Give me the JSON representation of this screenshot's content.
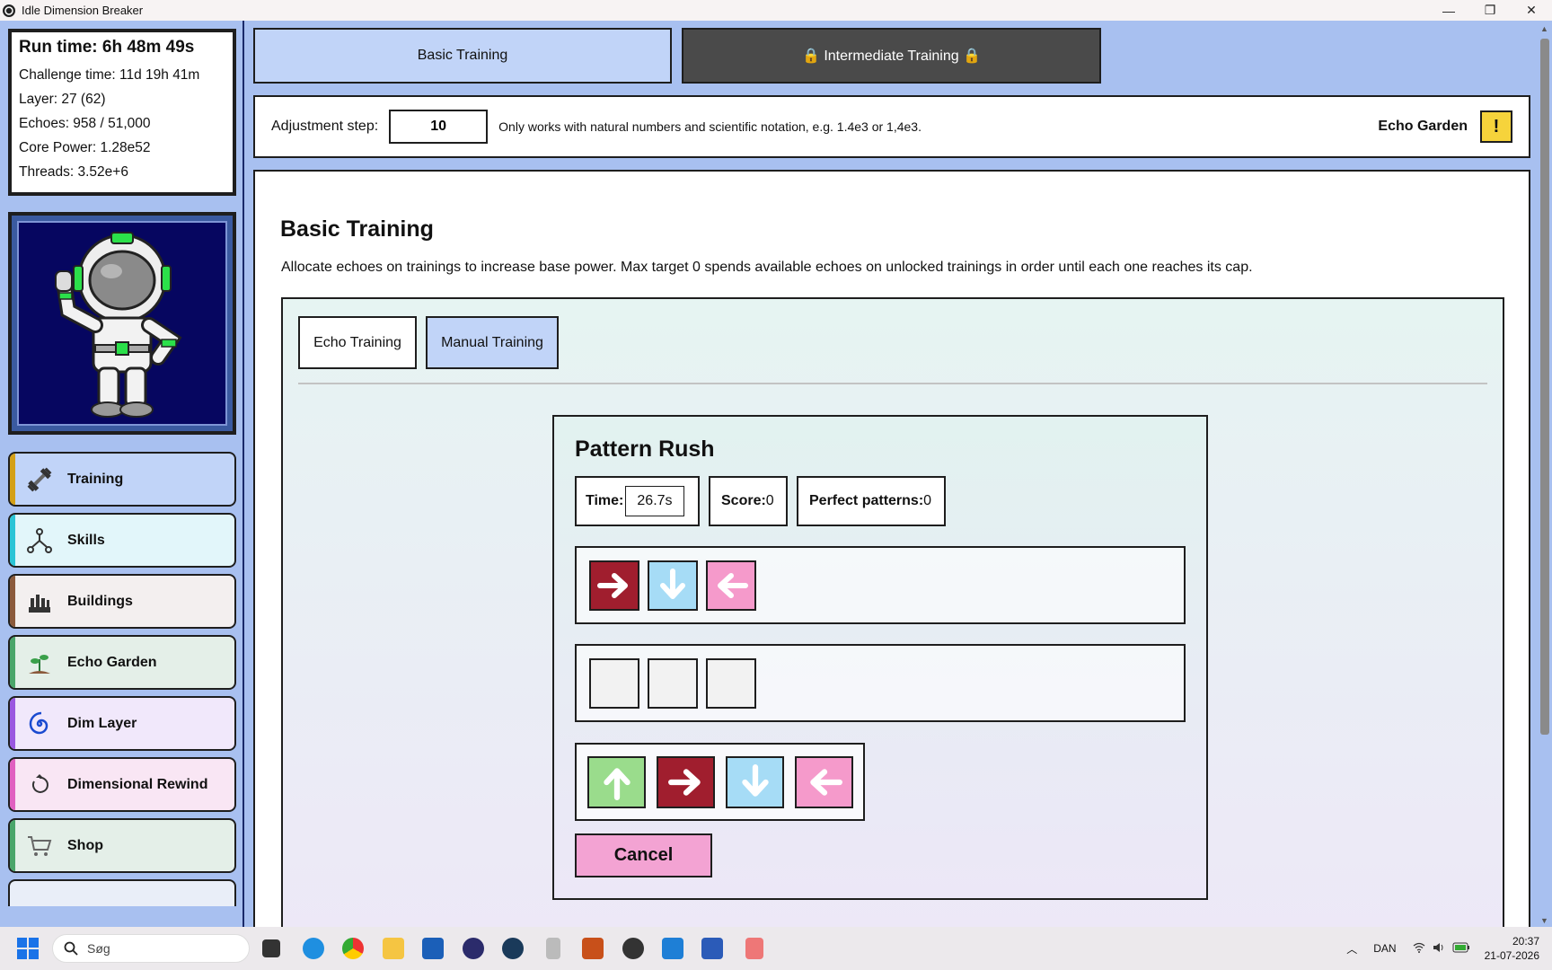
{
  "window": {
    "title": "Idle Dimension Breaker",
    "controls": [
      "—",
      "❐",
      "✕"
    ]
  },
  "stats": {
    "run_time": "Run time: 6h 48m 49s",
    "challenge_time": "Challenge time: 11d 19h 41m",
    "layer": "Layer: 27 (62)",
    "echoes": "Echoes: 958 / 51,000",
    "core_power": "Core Power: 1.28e52",
    "threads": "Threads: 3.52e+6"
  },
  "nav": [
    {
      "label": "Training",
      "bg": "#c1d4f8",
      "stripe": "#d4a017",
      "icon": "dumbbell-icon"
    },
    {
      "label": "Skills",
      "bg": "#e2f6fa",
      "stripe": "#2bc4d6",
      "icon": "skills-icon"
    },
    {
      "label": "Buildings",
      "bg": "#f3efef",
      "stripe": "#8b5a3c",
      "icon": "buildings-icon"
    },
    {
      "label": "Echo Garden",
      "bg": "#e4efe8",
      "stripe": "#4aa56a",
      "icon": "garden-icon"
    },
    {
      "label": "Dim Layer",
      "bg": "#f1e8fb",
      "stripe": "#9a58e0",
      "icon": "spiral-icon"
    },
    {
      "label": "Dimensional Rewind",
      "bg": "#f9e6f4",
      "stripe": "#e060c0",
      "icon": "rewind-icon"
    },
    {
      "label": "Shop",
      "bg": "#e4efe8",
      "stripe": "#4aa56a",
      "icon": "cart-icon"
    }
  ],
  "top_tabs": {
    "basic": "Basic Training",
    "intermediate": "🔒 Intermediate Training 🔒"
  },
  "adjust": {
    "label": "Adjustment step:",
    "value": "10",
    "hint": "Only works with natural numbers and scientific notation, e.g. 1.4e3 or 1,4e3.",
    "echo_garden": "Echo Garden",
    "alert": "!"
  },
  "main": {
    "title": "Basic Training",
    "description": "Allocate echoes on trainings to increase base power. Max target 0 spends available echoes on unlocked trainings in order until each one reaches its cap.",
    "subtabs": [
      "Echo Training",
      "Manual Training"
    ]
  },
  "pattern": {
    "title": "Pattern Rush",
    "time_label": "Time:",
    "time_value": "26.7s",
    "score_label": "Score:",
    "score_value": "0",
    "perfect_label": "Perfect patterns:",
    "perfect_value": "0",
    "target_sequence": [
      "right",
      "down",
      "left"
    ],
    "choices": [
      "up",
      "right",
      "down",
      "left"
    ],
    "cancel": "Cancel"
  },
  "taskbar": {
    "search_placeholder": "Søg",
    "language": "DAN",
    "time": "20:37",
    "date": "21-07-2026"
  }
}
